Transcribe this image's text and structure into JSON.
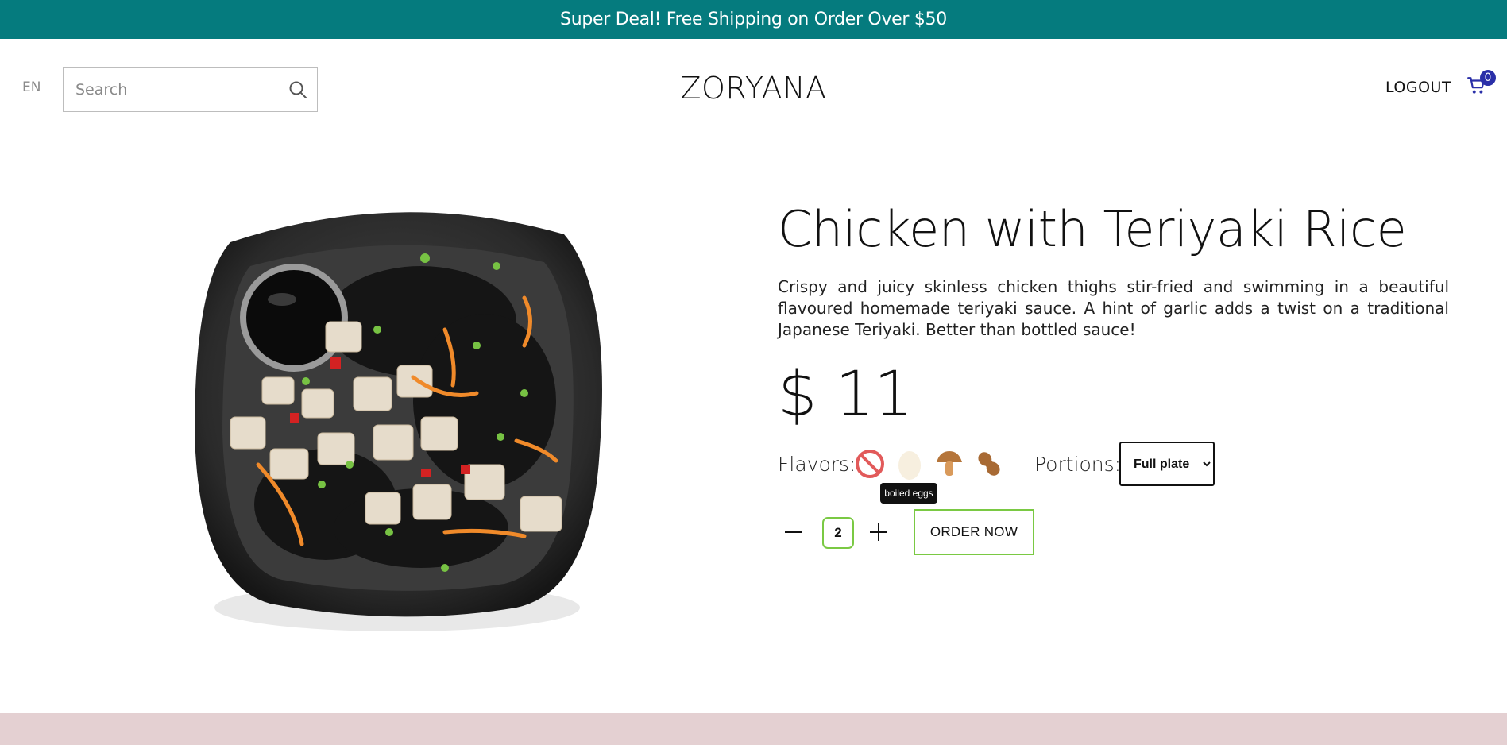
{
  "promo": {
    "text": "Super Deal! Free Shipping on Order Over $50"
  },
  "header": {
    "language": "EN",
    "search_placeholder": "Search",
    "brand": "ZORYANA",
    "logout_label": "LOGOUT",
    "cart_count": "0"
  },
  "product": {
    "title": "Chicken with Teriyaki Rice",
    "description": "Crispy and juicy skinless chicken thighs stir-fried and swimming in a beautiful flavoured homemade teriyaki sauce. A hint of garlic adds a twist on a traditional Japanese Teriyaki. Better than bottled sauce!",
    "price": "$ 11",
    "image_icon": "chicken-teriyaki-plate"
  },
  "options": {
    "flavors_label": "Flavors:",
    "flavors": [
      {
        "name": "none",
        "icon": "prohibited-icon"
      },
      {
        "name": "boiled eggs",
        "icon": "egg-icon"
      },
      {
        "name": "mushrooms",
        "icon": "mushroom-icon"
      },
      {
        "name": "peanuts",
        "icon": "peanut-icon"
      }
    ],
    "tooltip": "boiled eggs",
    "portions_label": "Portions:",
    "portion_selected": "Full plate"
  },
  "order": {
    "quantity": "2",
    "order_label": "ORDER NOW"
  },
  "colors": {
    "promo_bg": "#057b7e",
    "accent_green": "#7ac943",
    "cart_badge": "#2a2fa8",
    "footer_band": "#e4d0d2"
  }
}
